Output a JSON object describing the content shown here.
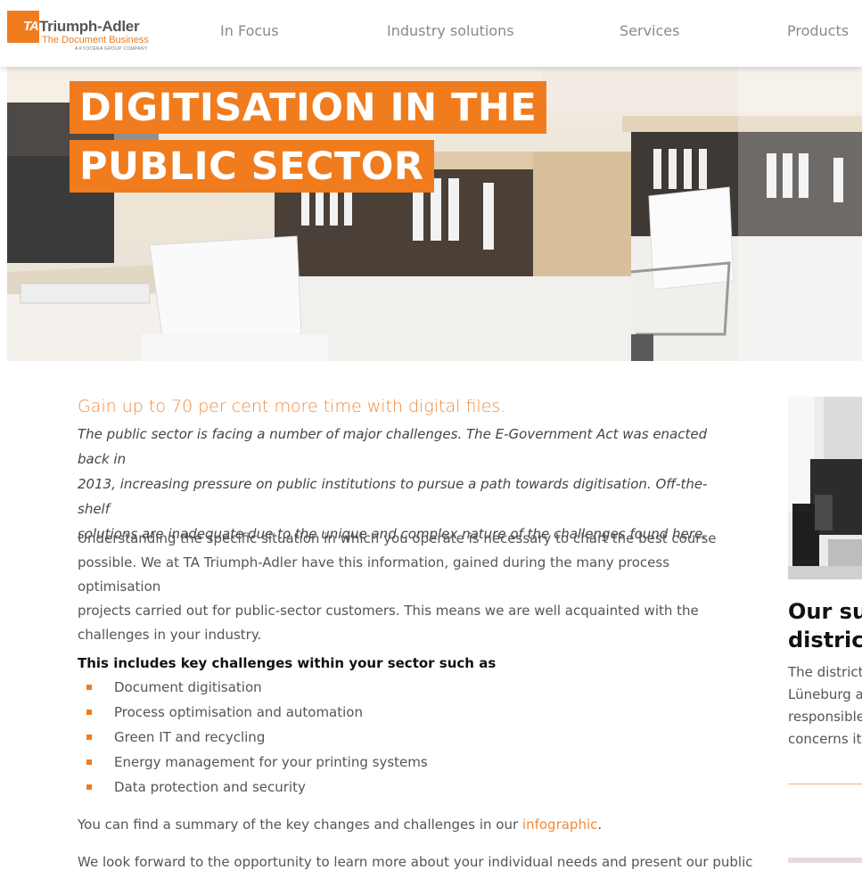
{
  "brand": {
    "mark": "TA",
    "name": "Triumph-Adler",
    "tagline": "The Document Business",
    "subline": "A KYOCERA GROUP COMPANY",
    "accent_color": "#f07c1e"
  },
  "nav": {
    "items": [
      {
        "label": "In Focus"
      },
      {
        "label": "Industry solutions"
      },
      {
        "label": "Services"
      },
      {
        "label": "Products"
      }
    ]
  },
  "hero": {
    "title_line1": "DIGITISATION IN THE",
    "title_line2": "PUBLIC SECTOR"
  },
  "content": {
    "lead": "Gain up to 70 per cent more time with digital files.",
    "intro_lines": [
      "The public sector is facing a number of major challenges. The E-Government Act was enacted back in",
      "2013, increasing pressure on public institutions to pursue a path towards digitisation. Off-the-shelf",
      "solutions are inadequate due to the unique and complex nature of the challenges found here."
    ],
    "paragraph_lines": [
      "Understanding the specific situation in which you operate is necessary to chart the best course",
      "possible. We at TA Triumph-Adler have this information, gained during the many process optimisation",
      "projects carried out for public-sector customers. This means we are well acquainted with the",
      "challenges in your industry."
    ],
    "list_title": "This includes key challenges within your sector such as",
    "list_items": [
      "Document digitisation",
      "Process optimisation and automation",
      "Green IT and recycling",
      "Energy management for your printing systems",
      "Data protection and security"
    ],
    "summary_prefix": "You can find a summary of the key changes and challenges in our ",
    "summary_link": "infographic",
    "summary_suffix": ".",
    "cut_line": "We look forward to the opportunity to learn more about your individual needs and present our public"
  },
  "sidebar": {
    "title_line1": "Our suc",
    "title_line2": "district",
    "text_lines": [
      "The district",
      "Lüneburg a",
      "responsible",
      "concerns its"
    ]
  }
}
